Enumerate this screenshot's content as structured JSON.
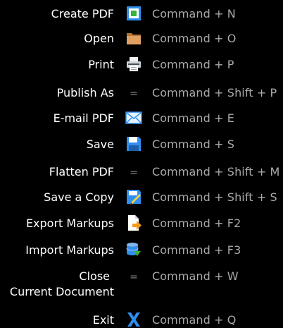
{
  "colors": {
    "background": "#000000",
    "label": "#ffffff",
    "shortcut": "#a9a9a9",
    "accent_blue": "#2f8ef0",
    "accent_green": "#3ab23a"
  },
  "items": [
    {
      "label": "Create PDF",
      "icon": "create-pdf-icon",
      "shortcut": "Command + N"
    },
    {
      "label": "Open",
      "icon": "folder-icon",
      "shortcut": "Command + O"
    },
    {
      "label": "Print",
      "icon": "printer-icon",
      "shortcut": "Command + P"
    },
    {
      "label": "Publish As",
      "icon": "=",
      "shortcut": "Command + Shift + P"
    },
    {
      "label": "E-mail PDF",
      "icon": "envelope-icon",
      "shortcut": "Command + E"
    },
    {
      "label": "Save",
      "icon": "floppy-disk-icon",
      "shortcut": "Command + S"
    },
    {
      "label": "Flatten PDF",
      "icon": "=",
      "shortcut": "Command + Shift + M"
    },
    {
      "label": "Save a Copy",
      "icon": "save-copy-icon",
      "shortcut": "Command + Shift + S"
    },
    {
      "label": "Export Markups",
      "icon": "export-markups-icon",
      "shortcut": "Command + F2"
    },
    {
      "label": "Import Markups",
      "icon": "import-markups-icon",
      "shortcut": "Command + F3"
    },
    {
      "label": "Close",
      "label_line2": "Current Document",
      "icon": "=",
      "shortcut": "Command + W"
    },
    {
      "label": "Exit",
      "icon": "exit-icon",
      "shortcut": "Command + Q"
    }
  ]
}
